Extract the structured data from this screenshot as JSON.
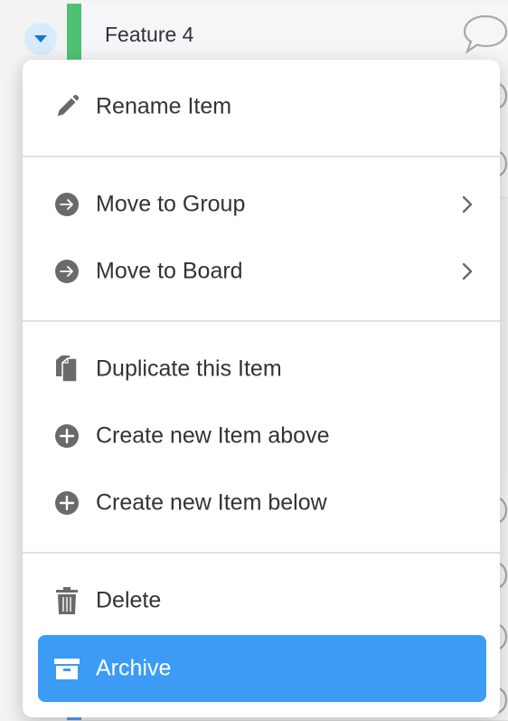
{
  "board": {
    "item_name": "Feature 4",
    "group_color": "#4ec274",
    "bottom_group_color": "#579bfc"
  },
  "menu": {
    "rename": "Rename Item",
    "move_group": "Move to Group",
    "move_board": "Move to Board",
    "duplicate": "Duplicate this Item",
    "create_above": "Create new Item above",
    "create_below": "Create new Item below",
    "delete": "Delete",
    "archive": "Archive"
  },
  "icons": {
    "rename": "pencil-icon",
    "move_group": "arrow-right-circle-icon",
    "move_board": "arrow-right-circle-icon",
    "duplicate": "duplicate-icon",
    "create_above": "plus-circle-icon",
    "create_below": "plus-circle-icon",
    "delete": "trash-icon",
    "archive": "archive-box-icon",
    "submenu": "chevron-right-icon",
    "collapse": "caret-down-icon",
    "updates": "speech-bubble-icon"
  },
  "colors": {
    "accent": "#3c9bf5",
    "icon": "#6a6a6a",
    "text": "#323338"
  }
}
